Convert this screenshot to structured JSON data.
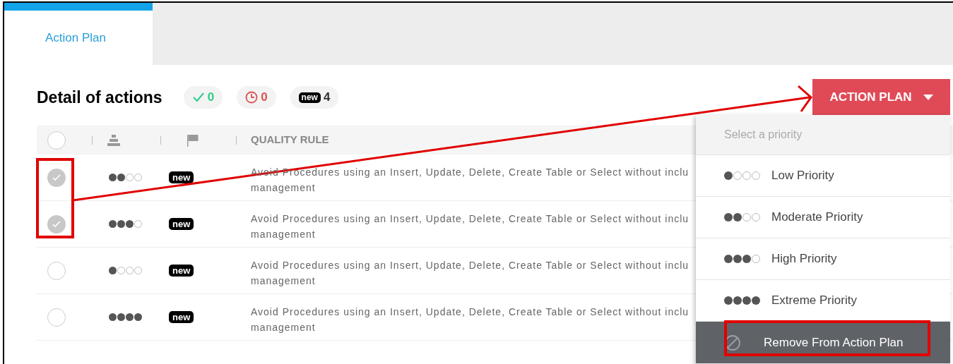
{
  "tabs": [
    {
      "label": "Action Plan",
      "selected": true
    }
  ],
  "heading": "Detail of actions",
  "counters": [
    {
      "kind": "done",
      "value": "0"
    },
    {
      "kind": "pending",
      "value": "0"
    },
    {
      "kind": "new",
      "label": "new",
      "value": "4"
    }
  ],
  "action_button": {
    "label": "ACTION PLAN"
  },
  "table": {
    "select_all": {
      "checked": false
    },
    "columns": [
      "QUALITY RULE"
    ],
    "rows": [
      {
        "checked": true,
        "stars": 2,
        "badge": "new",
        "rule": [
          "Avoid Procedures using an Insert, Update, Delete, Create Table or Select without inclu",
          "management"
        ]
      },
      {
        "checked": true,
        "stars": 3,
        "badge": "new",
        "rule": [
          "Avoid Procedures using an Insert, Update, Delete, Create Table or Select without inclu",
          "management"
        ]
      },
      {
        "checked": false,
        "stars": 1,
        "badge": "new",
        "rule": [
          "Avoid Procedures using an Insert, Update, Delete, Create Table or Select without inclu",
          "management"
        ]
      },
      {
        "checked": false,
        "stars": 4,
        "badge": "new",
        "rule": [
          "Avoid Procedures using an Insert, Update, Delete, Create Table or Select without inclu",
          "management"
        ]
      }
    ]
  },
  "dropdown": {
    "title": "Select a priority",
    "items": [
      {
        "kind": "priority",
        "stars": 1,
        "label": "Low Priority",
        "selected": false
      },
      {
        "kind": "priority",
        "stars": 2,
        "label": "Moderate Priority",
        "selected": false
      },
      {
        "kind": "priority",
        "stars": 3,
        "label": "High Priority",
        "selected": false
      },
      {
        "kind": "priority",
        "stars": 4,
        "label": "Extreme Priority",
        "selected": false
      },
      {
        "kind": "remove",
        "label": "Remove From Action Plan",
        "selected": true
      }
    ]
  }
}
